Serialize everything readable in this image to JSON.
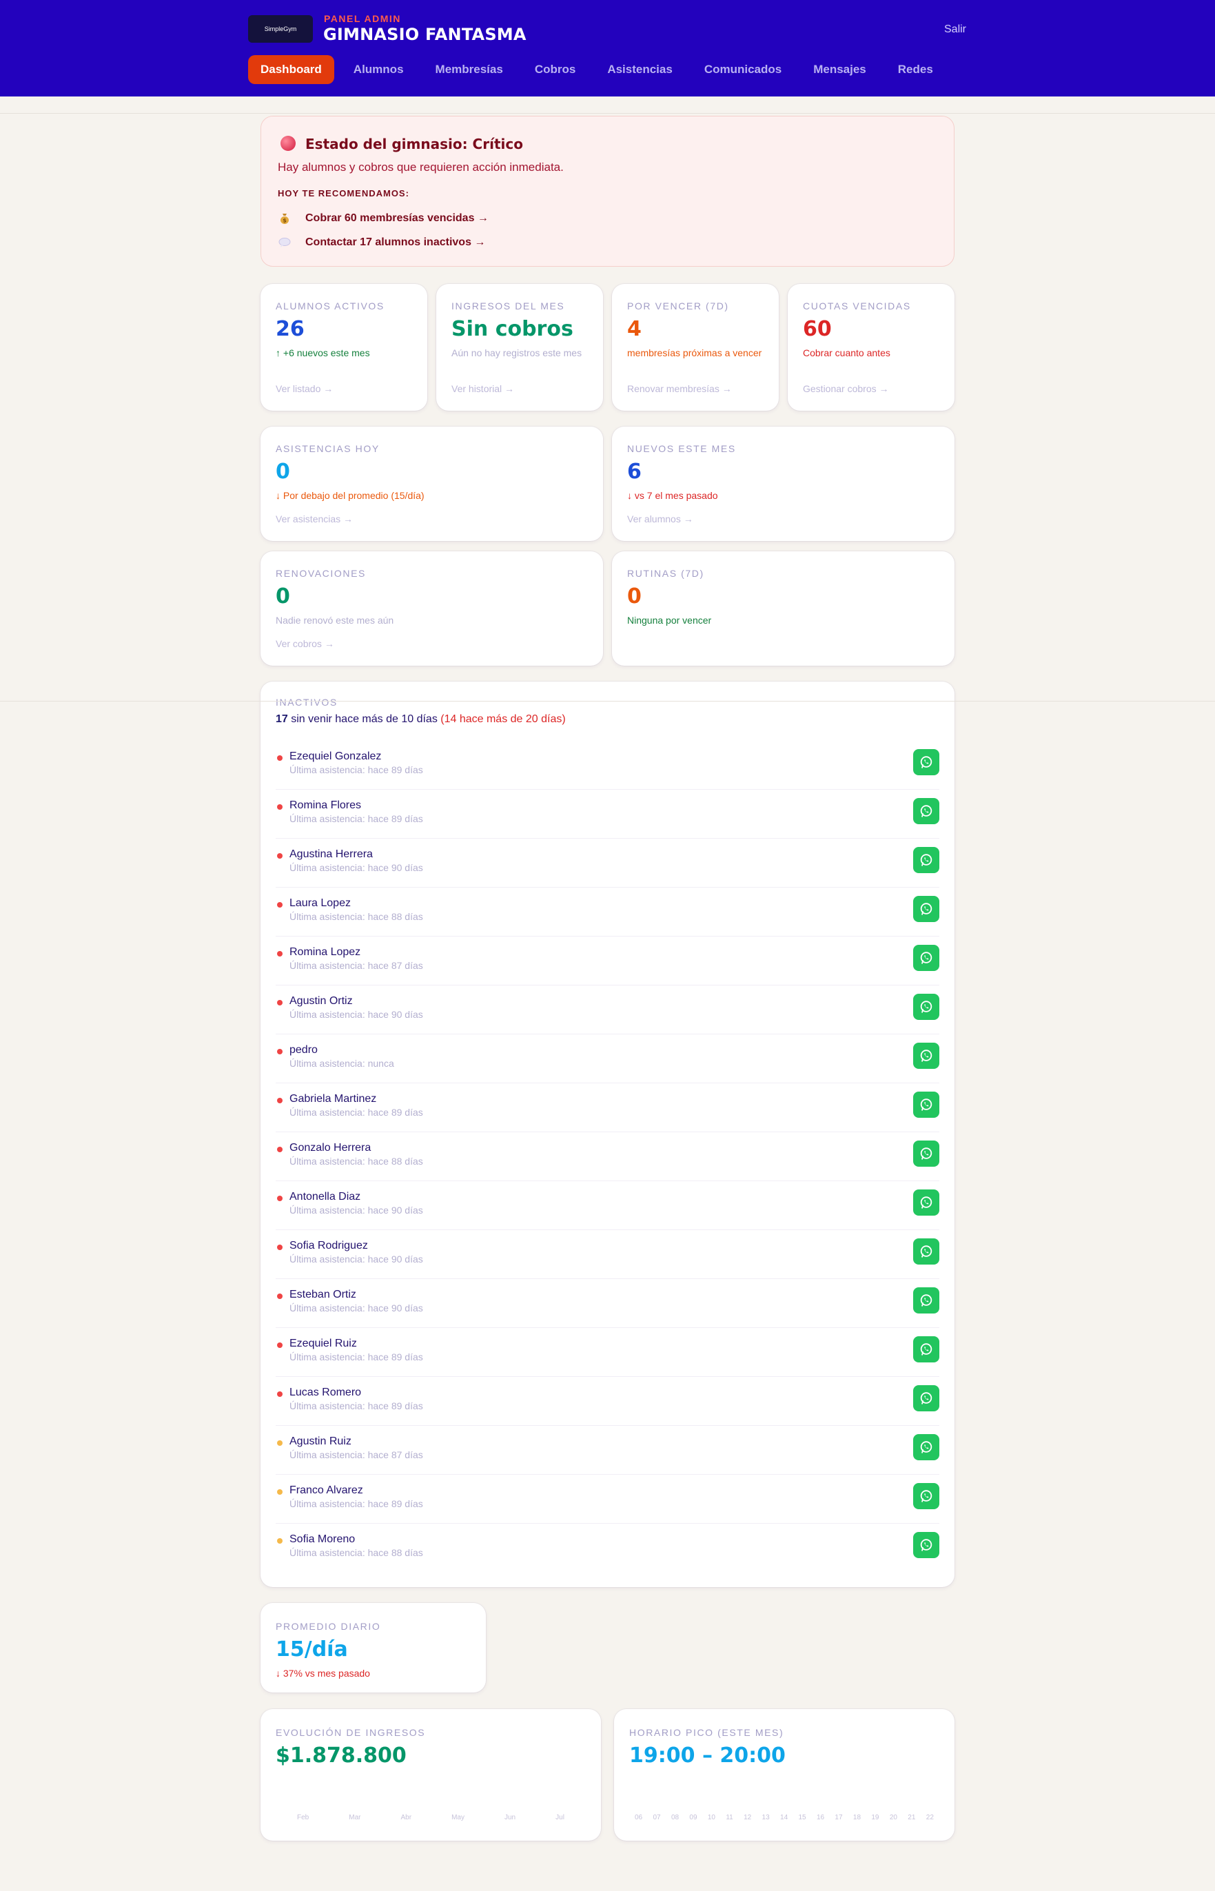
{
  "header": {
    "logo_text": "SimpleGym",
    "subtitle": "PANEL ADMIN",
    "title": "GIMNASIO FANTASMA",
    "logout_label": "Salir",
    "nav": [
      "Dashboard",
      "Alumnos",
      "Membresías",
      "Cobros",
      "Asistencias",
      "Comunicados",
      "Mensajes",
      "Redes"
    ],
    "active_nav": "Dashboard"
  },
  "alert": {
    "title": "Estado del gimnasio: Crítico",
    "text": "Hay alumnos y cobros que requieren acción inmediata.",
    "reco_label": "HOY TE RECOMENDAMOS:",
    "items": [
      {
        "icon": "money-bag-icon",
        "label": "Cobrar 60 membresías vencidas →"
      },
      {
        "icon": "speech-bubble-icon",
        "label": "Contactar 17 alumnos inactivos →"
      }
    ]
  },
  "stats": [
    {
      "label": "ALUMNOS ACTIVOS",
      "value": "26",
      "color": "#1d4ed8",
      "sub": "↑ +6 nuevos este mes",
      "sub_color": "#15803d",
      "link": "Ver listado →"
    },
    {
      "label": "INGRESOS DEL MES",
      "value": "Sin cobros",
      "color": "#059669",
      "sub": "Aún no hay registros este mes",
      "sub_color": "#b3afcf",
      "link": "Ver historial →"
    },
    {
      "label": "POR VENCER (7D)",
      "value": "4",
      "color": "#ea580c",
      "sub": "membresías próximas a vencer",
      "sub_color": "#ea580c",
      "link": "Renovar membresías →"
    },
    {
      "label": "CUOTAS VENCIDAS",
      "value": "60",
      "color": "#dc2626",
      "sub": "Cobrar cuanto antes",
      "sub_color": "#dc2626",
      "link": "Gestionar cobros →"
    }
  ],
  "wide_stats": [
    {
      "label": "ASISTENCIAS HOY",
      "value": "0",
      "color": "#0ea5e9",
      "sub": "↓ Por debajo del promedio (15/día)",
      "sub_color": "#ea580c",
      "link": "Ver asistencias →"
    },
    {
      "label": "NUEVOS ESTE MES",
      "value": "6",
      "color": "#1d4ed8",
      "sub": "↓ vs 7 el mes pasado",
      "sub_color": "#dc2626",
      "link": "Ver alumnos →"
    },
    {
      "label": "RENOVACIONES",
      "value": "0",
      "color": "#059669",
      "sub": "Nadie renovó este mes aún",
      "sub_color": "#b3afcf",
      "link": "Ver cobros →"
    },
    {
      "label": "RUTINAS (7D)",
      "value": "0",
      "color": "#ea580c",
      "sub": "Ninguna por vencer",
      "sub_color": "#15803d",
      "link": ""
    }
  ],
  "inactive": {
    "label": "INACTIVOS",
    "count": "17",
    "summary": "sin venir hace más de 10 días",
    "summary_extra": "(14 hace más de 20 días)",
    "students": [
      {
        "name": "Ezequiel Gonzalez",
        "last": "Última asistencia: hace 89 días",
        "severity": "high"
      },
      {
        "name": "Romina Flores",
        "last": "Última asistencia: hace 89 días",
        "severity": "high"
      },
      {
        "name": "Agustina Herrera",
        "last": "Última asistencia: hace 90 días",
        "severity": "high"
      },
      {
        "name": "Laura Lopez",
        "last": "Última asistencia: hace 88 días",
        "severity": "high"
      },
      {
        "name": "Romina Lopez",
        "last": "Última asistencia: hace 87 días",
        "severity": "high"
      },
      {
        "name": "Agustin Ortiz",
        "last": "Última asistencia: hace 90 días",
        "severity": "high"
      },
      {
        "name": "pedro",
        "last": "Última asistencia: nunca",
        "severity": "high"
      },
      {
        "name": "Gabriela Martinez",
        "last": "Última asistencia: hace 89 días",
        "severity": "high"
      },
      {
        "name": "Gonzalo Herrera",
        "last": "Última asistencia: hace 88 días",
        "severity": "high"
      },
      {
        "name": "Antonella Diaz",
        "last": "Última asistencia: hace 90 días",
        "severity": "high"
      },
      {
        "name": "Sofia Rodriguez",
        "last": "Última asistencia: hace 90 días",
        "severity": "high"
      },
      {
        "name": "Esteban Ortiz",
        "last": "Última asistencia: hace 90 días",
        "severity": "high"
      },
      {
        "name": "Ezequiel Ruiz",
        "last": "Última asistencia: hace 89 días",
        "severity": "high"
      },
      {
        "name": "Lucas Romero",
        "last": "Última asistencia: hace 89 días",
        "severity": "high"
      },
      {
        "name": "Agustin Ruiz",
        "last": "Última asistencia: hace 87 días",
        "severity": "medium"
      },
      {
        "name": "Franco Alvarez",
        "last": "Última asistencia: hace 89 días",
        "severity": "medium"
      },
      {
        "name": "Sofia Moreno",
        "last": "Última asistencia: hace 88 días",
        "severity": "medium"
      }
    ]
  },
  "average": {
    "label": "PROMEDIO DIARIO",
    "value": "15/día",
    "sub": "↓ 37% vs mes pasado"
  },
  "income_evolution": {
    "label": "EVOLUCIÓN DE INGRESOS",
    "value": "$1.878.800",
    "months": [
      "Feb",
      "Mar",
      "Abr",
      "May",
      "Jun",
      "Jul"
    ]
  },
  "peak_hours": {
    "label": "HORARIO PICO (ESTE MES)",
    "value": "19:00 – 20:00",
    "hours": [
      "06",
      "07",
      "08",
      "09",
      "10",
      "11",
      "12",
      "13",
      "14",
      "15",
      "16",
      "17",
      "18",
      "19",
      "20",
      "21",
      "22"
    ]
  },
  "colors": {
    "header_bg": "#2302bd",
    "accent": "#e23a0c",
    "whatsapp": "#22c55e",
    "severity_high": "#ef4444",
    "severity_medium": "#f5b94a"
  }
}
